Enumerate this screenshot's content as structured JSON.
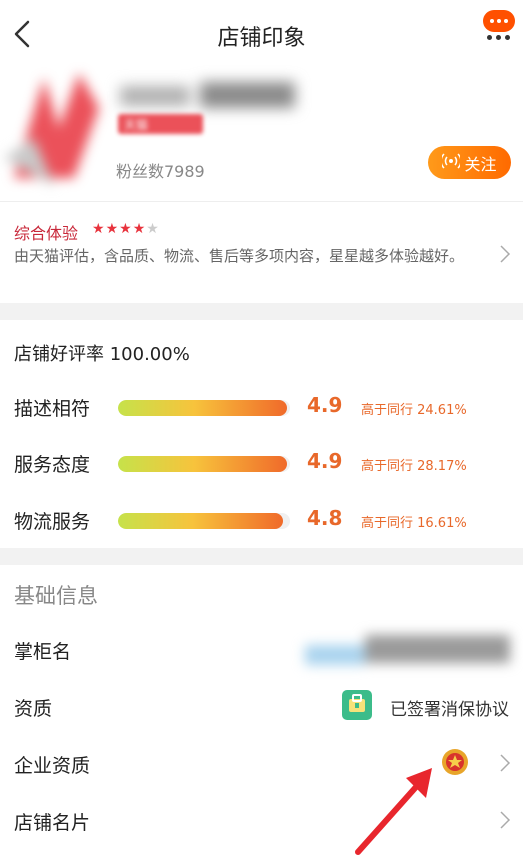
{
  "header": {
    "title": "店铺印象"
  },
  "shop": {
    "fans": "粉丝数7989",
    "follow_label": "关注",
    "tag_text": "天猫"
  },
  "experience": {
    "title": "综合体验",
    "rating": 4,
    "max_rating": 5,
    "description": "由天猫评估，含品质、物流、售后等多项内容，星星越多体验越好。"
  },
  "ratings": {
    "good_rate": "店铺好评率 100.00%",
    "rows": [
      {
        "label": "描述相符",
        "score": "4.9",
        "compare": "高于同行 24.61%",
        "fill": 0.98
      },
      {
        "label": "服务态度",
        "score": "4.9",
        "compare": "高于同行 28.17%",
        "fill": 0.98
      },
      {
        "label": "物流服务",
        "score": "4.8",
        "compare": "高于同行 16.61%",
        "fill": 0.96
      }
    ]
  },
  "basic": {
    "title": "基础信息",
    "owner_label": "掌柜名",
    "qualification_label": "资质",
    "qualification_value": "已签署消保协议",
    "enterprise_label": "企业资质",
    "card_label": "店铺名片"
  },
  "colors": {
    "accent": "#ff5000",
    "rating_text": "#e8682a",
    "experience_red": "#c8283a"
  }
}
